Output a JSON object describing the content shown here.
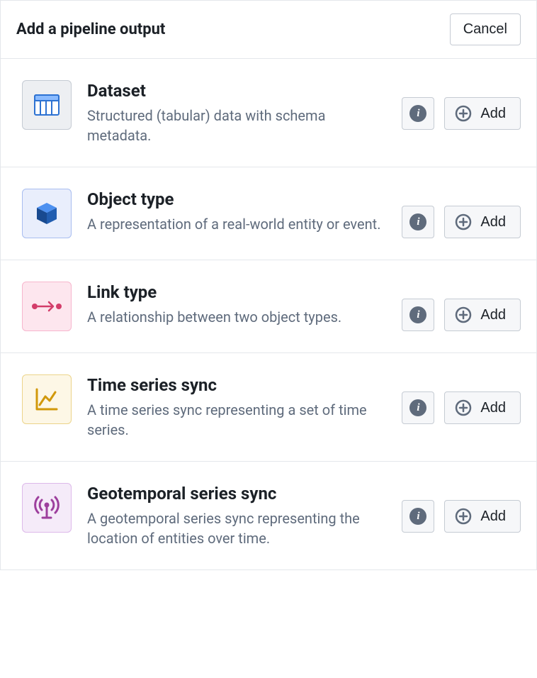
{
  "header": {
    "title": "Add a pipeline output",
    "cancel_label": "Cancel"
  },
  "add_label": "Add",
  "types": [
    {
      "id": "dataset",
      "title": "Dataset",
      "description": "Structured (tabular) data with schema metadata.",
      "icon": "dataset-icon",
      "tile_class": "tile-dataset"
    },
    {
      "id": "object-type",
      "title": "Object type",
      "description": "A representation of a real-world entity or event.",
      "icon": "cube-icon",
      "tile_class": "tile-object"
    },
    {
      "id": "link-type",
      "title": "Link type",
      "description": "A relationship between two object types.",
      "icon": "link-icon",
      "tile_class": "tile-link"
    },
    {
      "id": "time-series-sync",
      "title": "Time series sync",
      "description": "A time series sync representing a set of time series.",
      "icon": "chart-line-icon",
      "tile_class": "tile-time"
    },
    {
      "id": "geotemporal-series-sync",
      "title": "Geotemporal series sync",
      "description": "A geotemporal series sync representing the location of entities over time.",
      "icon": "antenna-icon",
      "tile_class": "tile-geo"
    }
  ]
}
